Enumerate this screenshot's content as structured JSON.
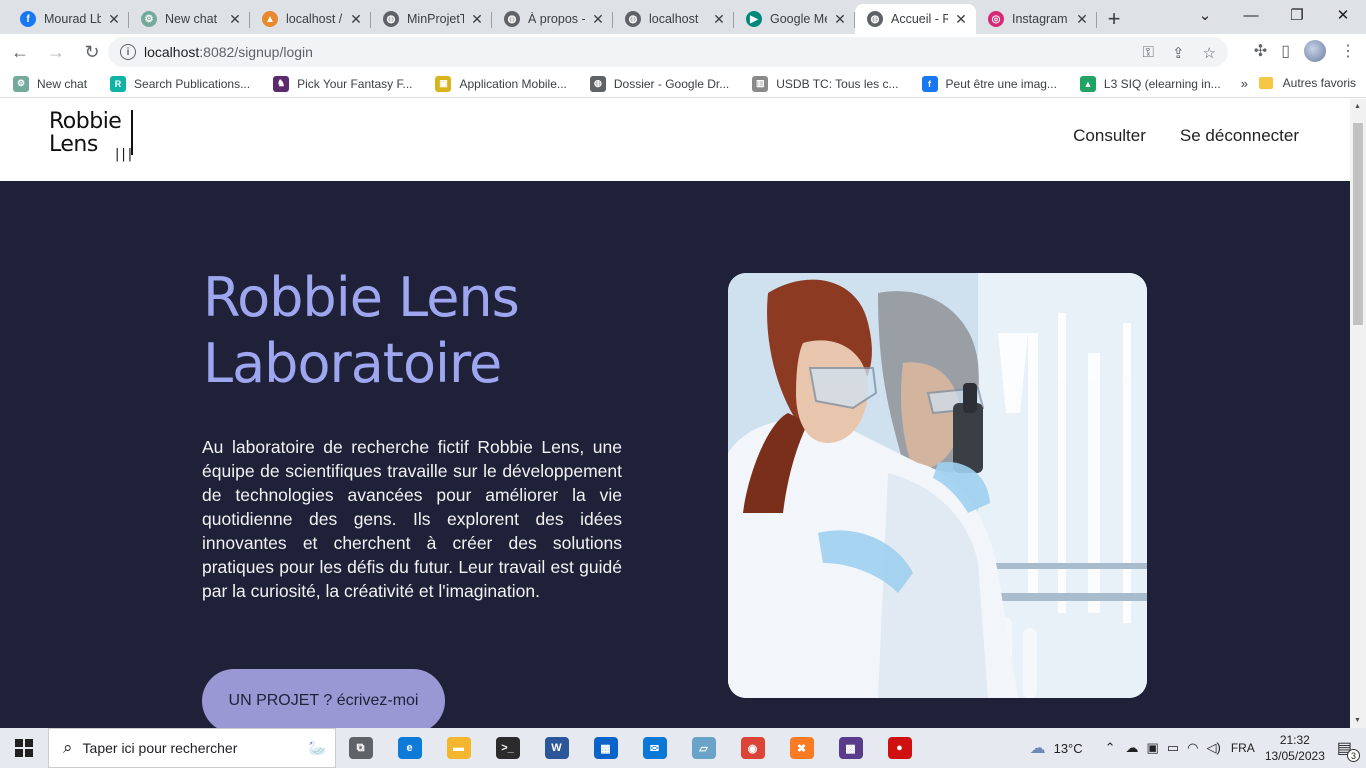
{
  "browser": {
    "tabs": [
      {
        "title": "Mourad Lb",
        "icon": "facebook-icon",
        "color": "#1877f2",
        "glyph": "f"
      },
      {
        "title": "New chat",
        "icon": "chatgpt-icon",
        "color": "#74aa9c",
        "glyph": "⚙"
      },
      {
        "title": "localhost /",
        "icon": "phpmyadmin-icon",
        "color": "#e8892c",
        "glyph": "▲"
      },
      {
        "title": "MinProjetT",
        "icon": "globe-icon",
        "color": "#5f6368",
        "glyph": "◍"
      },
      {
        "title": "À propos -",
        "icon": "globe-icon",
        "color": "#5f6368",
        "glyph": "◍"
      },
      {
        "title": "localhost",
        "icon": "globe-icon",
        "color": "#5f6368",
        "glyph": "◍"
      },
      {
        "title": "Google Me",
        "icon": "google-meet-icon",
        "color": "#00897b",
        "glyph": "▶"
      },
      {
        "title": "Accueil - R",
        "icon": "globe-icon",
        "color": "#5f6368",
        "glyph": "◍"
      },
      {
        "title": "Instagram",
        "icon": "instagram-icon",
        "color": "#d62976",
        "glyph": "◎"
      }
    ],
    "url_host": "localhost",
    "url_path": ":8082/signup/login",
    "bookmarks": [
      {
        "label": "New chat",
        "color": "#74aa9c",
        "glyph": "⚙"
      },
      {
        "label": "Search Publications...",
        "color": "#10b2a4",
        "glyph": "R"
      },
      {
        "label": "Pick Your Fantasy F...",
        "color": "#5a2a6a",
        "glyph": "♞"
      },
      {
        "label": "Application Mobile...",
        "color": "#d8b41c",
        "glyph": "▣"
      },
      {
        "label": "Dossier - Google Dr...",
        "color": "#5f6368",
        "glyph": "◍"
      },
      {
        "label": "USDB TC: Tous les c...",
        "color": "#8a8a8a",
        "glyph": "▥"
      },
      {
        "label": "Peut être une imag...",
        "color": "#1877f2",
        "glyph": "f"
      },
      {
        "label": "L3 SIQ (elearning in...",
        "color": "#1fa463",
        "glyph": "▲"
      }
    ],
    "bookmarks_more": "»",
    "other_bookmarks": "Autres favoris"
  },
  "site": {
    "logo_line1": "Robbie",
    "logo_line2": "Lens",
    "nav": [
      "Consulter",
      "Se déconnecter"
    ],
    "hero_title_line1": "Robbie Lens",
    "hero_title_line2": "Laboratoire",
    "hero_text": "Au laboratoire de recherche fictif Robbie Lens, une équipe de scientifiques travaille sur le développement de technologies avancées pour améliorer la vie quotidienne des gens. Ils explorent des idées innovantes et cherchent à créer des solutions pratiques pour les défis du futur. Leur travail est guidé par la curiosité, la créativité et l'imagination.",
    "cta_label": "UN PROJET ? écrivez-moi"
  },
  "taskbar": {
    "search_placeholder": "Taper ici pour rechercher",
    "apps": [
      {
        "name": "task-view-icon",
        "color": "#5f6368",
        "glyph": "⧉"
      },
      {
        "name": "edge-icon",
        "color": "#0f7bd8",
        "glyph": "e"
      },
      {
        "name": "file-explorer-icon",
        "color": "#f3b62c",
        "glyph": "▬"
      },
      {
        "name": "terminal-icon",
        "color": "#2b2b2b",
        "glyph": ">_"
      },
      {
        "name": "word-icon",
        "color": "#2b579a",
        "glyph": "W"
      },
      {
        "name": "store-icon",
        "color": "#0a63c9",
        "glyph": "▦"
      },
      {
        "name": "mail-icon",
        "color": "#0a78d4",
        "glyph": "✉"
      },
      {
        "name": "notes-icon",
        "color": "#6aa3c8",
        "glyph": "▱"
      },
      {
        "name": "chrome-icon",
        "color": "#db4437",
        "glyph": "◉"
      },
      {
        "name": "xampp-icon",
        "color": "#fb7a24",
        "glyph": "✖"
      },
      {
        "name": "game-icon",
        "color": "#5a3d8a",
        "glyph": "▩"
      },
      {
        "name": "record-icon",
        "color": "#d01010",
        "glyph": "●"
      }
    ],
    "weather": "13°C",
    "language": "FRA",
    "time": "21:32",
    "date": "13/05/2023",
    "notifications": "3"
  }
}
